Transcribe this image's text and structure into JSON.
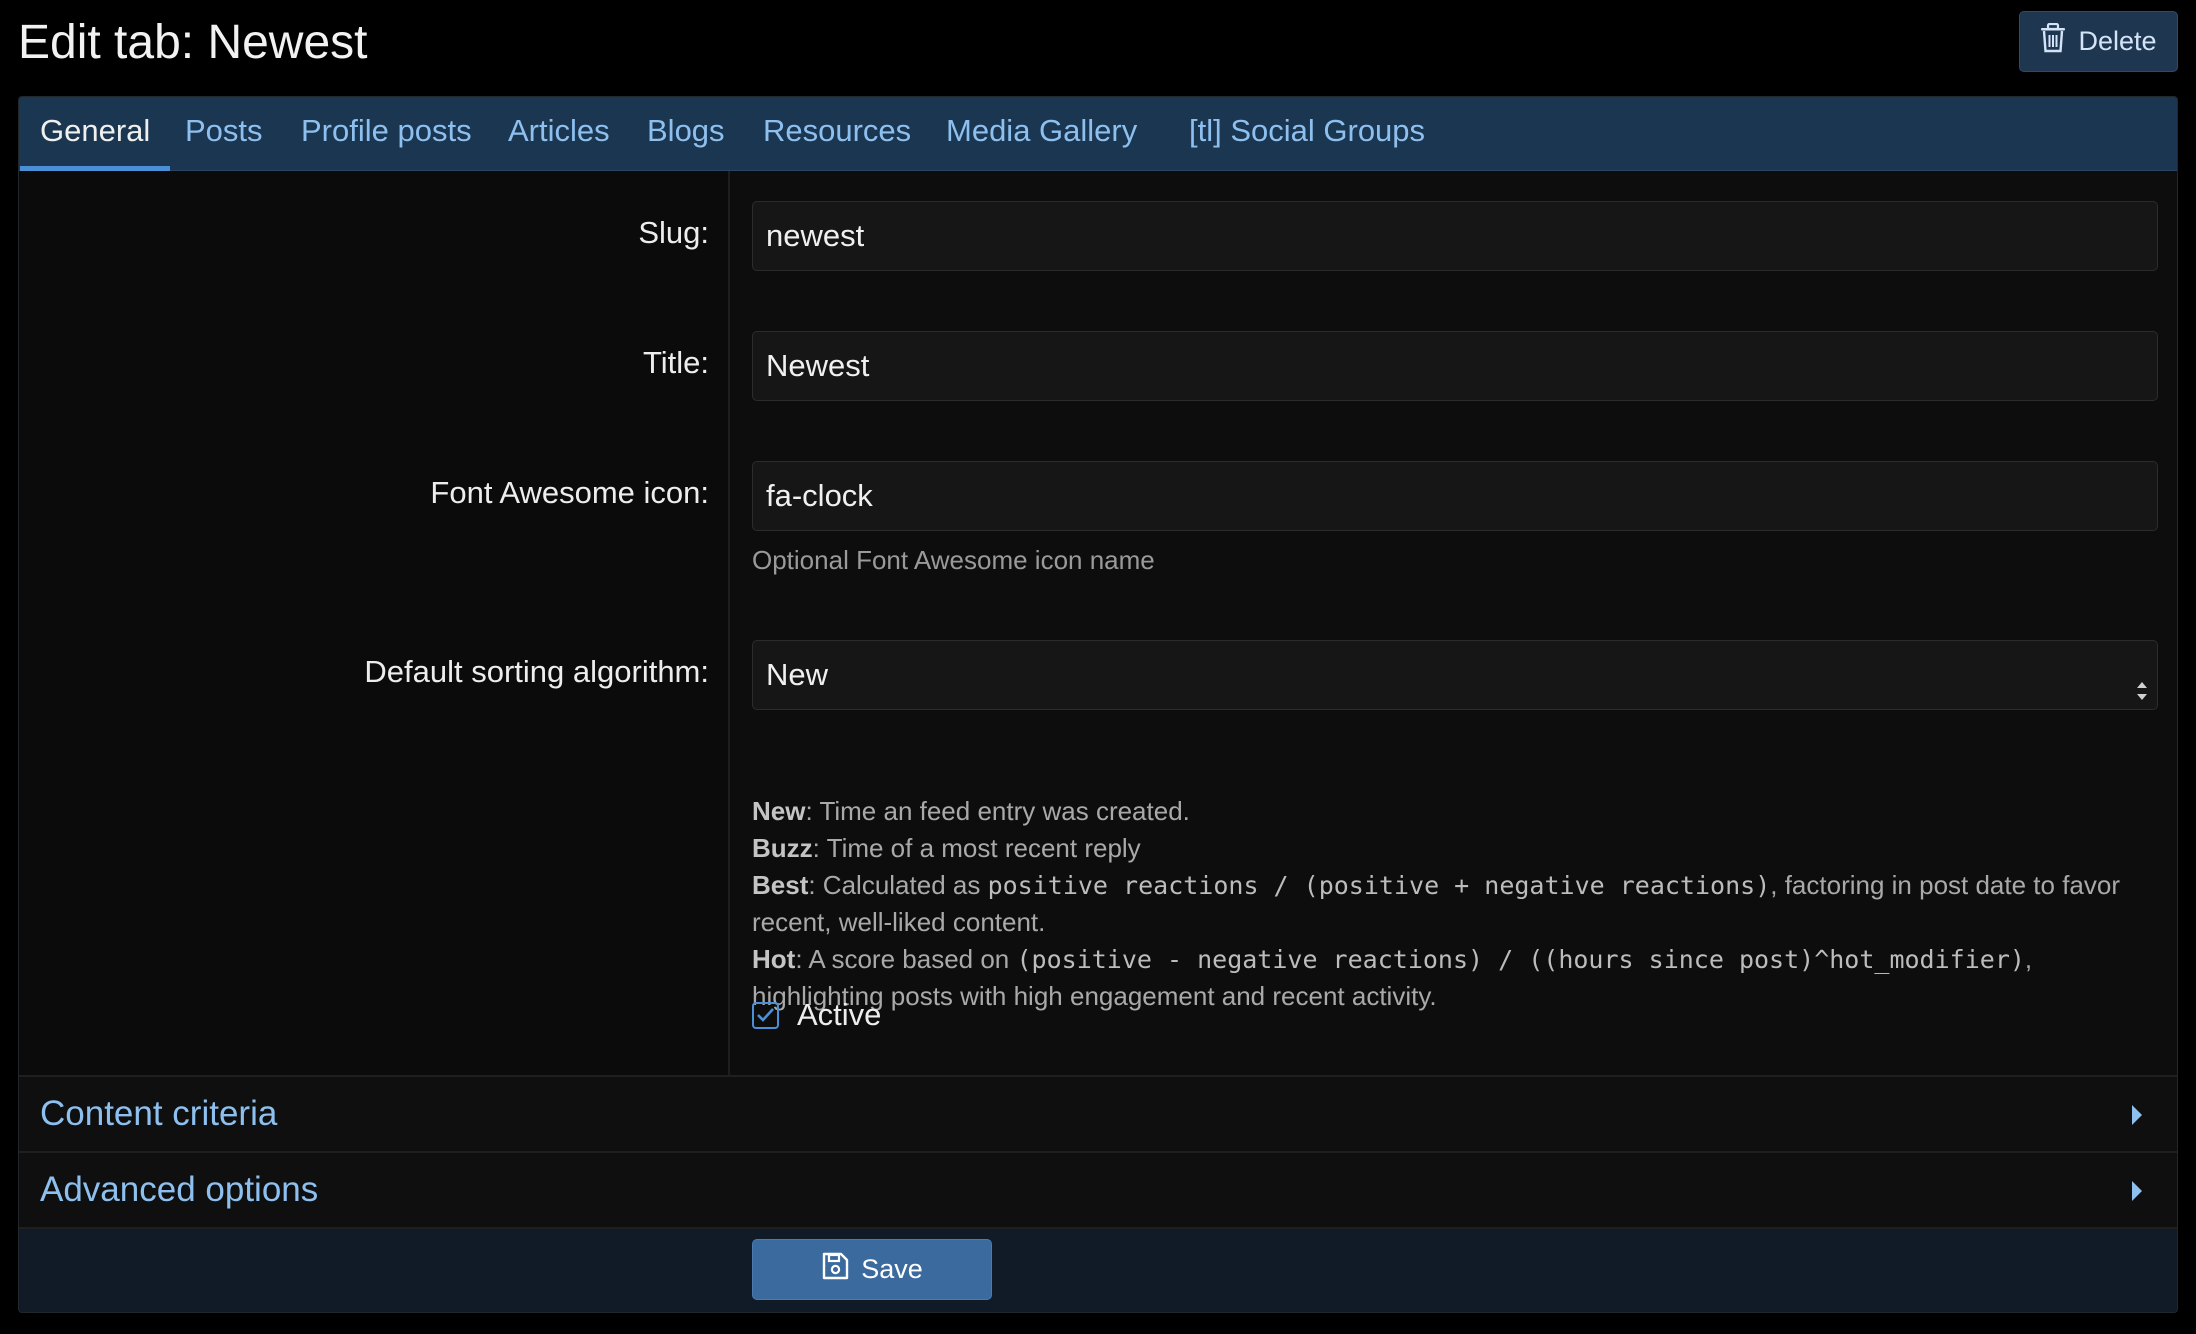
{
  "header": {
    "title": "Edit tab: Newest",
    "delete_label": "Delete"
  },
  "tabs": [
    {
      "label": "General",
      "active": true
    },
    {
      "label": "Posts"
    },
    {
      "label": "Profile posts"
    },
    {
      "label": "Articles"
    },
    {
      "label": "Blogs"
    },
    {
      "label": "Resources"
    },
    {
      "label": "Media Gallery"
    },
    {
      "label": "[tl] Social Groups"
    }
  ],
  "form": {
    "slug": {
      "label": "Slug:",
      "value": "newest"
    },
    "title": {
      "label": "Title:",
      "value": "Newest"
    },
    "icon": {
      "label": "Font Awesome icon:",
      "value": "fa-clock",
      "hint": "Optional Font Awesome icon name"
    },
    "sorting": {
      "label": "Default sorting algorithm:",
      "value": "New",
      "explanations": {
        "new": {
          "name": "New",
          "text": ": Time an feed entry was created."
        },
        "buzz": {
          "name": "Buzz",
          "text": ": Time of a most recent reply"
        },
        "best": {
          "name": "Best",
          "pre": ": Calculated as ",
          "code": "positive reactions / (positive + negative reactions)",
          "post": ", factoring in post date to favor recent, well-liked content."
        },
        "hot": {
          "name": "Hot",
          "pre": ": A score based on ",
          "code": "(positive - negative reactions) / ((hours since post)^hot_modifier)",
          "post": ", highlighting posts with high engagement and recent activity."
        }
      }
    },
    "active": {
      "label": "Active",
      "checked": true
    }
  },
  "sections": {
    "content_criteria": "Content criteria",
    "advanced_options": "Advanced options"
  },
  "footer": {
    "save_label": "Save"
  },
  "colors": {
    "accent": "#4b8fd6",
    "tab_bar": "#1b3650",
    "link": "#8ec0ef",
    "save_button": "#3a6a9e"
  }
}
